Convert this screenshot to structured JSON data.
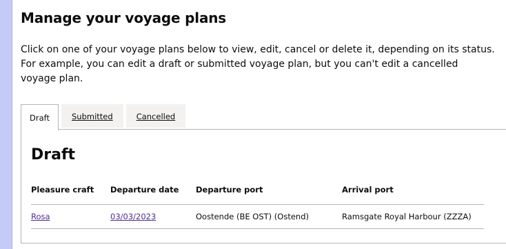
{
  "page": {
    "title": "Manage your voyage plans",
    "intro": "Click on one of your voyage plans below to view, edit, cancel or delete it, depending on its status. For example, you can edit a draft or submitted voyage plan, but you can't edit a cancelled voyage plan."
  },
  "tabs": [
    {
      "label": "Draft",
      "selected": true
    },
    {
      "label": "Submitted",
      "selected": false
    },
    {
      "label": "Cancelled",
      "selected": false
    }
  ],
  "panel": {
    "heading": "Draft",
    "table": {
      "headers": [
        "Pleasure craft",
        "Departure date",
        "Departure port",
        "Arrival port"
      ],
      "rows": [
        [
          "Rosa",
          "03/03/2023",
          "Oostende (BE OST) (Ostend)",
          "Ramsgate Royal Harbour (ZZZA)"
        ]
      ]
    }
  },
  "colors": {
    "background": "#c5cbf7",
    "link_visited": "#4c2c92",
    "border": "#b1b4b6",
    "tab_inactive": "#f3f2f1"
  }
}
